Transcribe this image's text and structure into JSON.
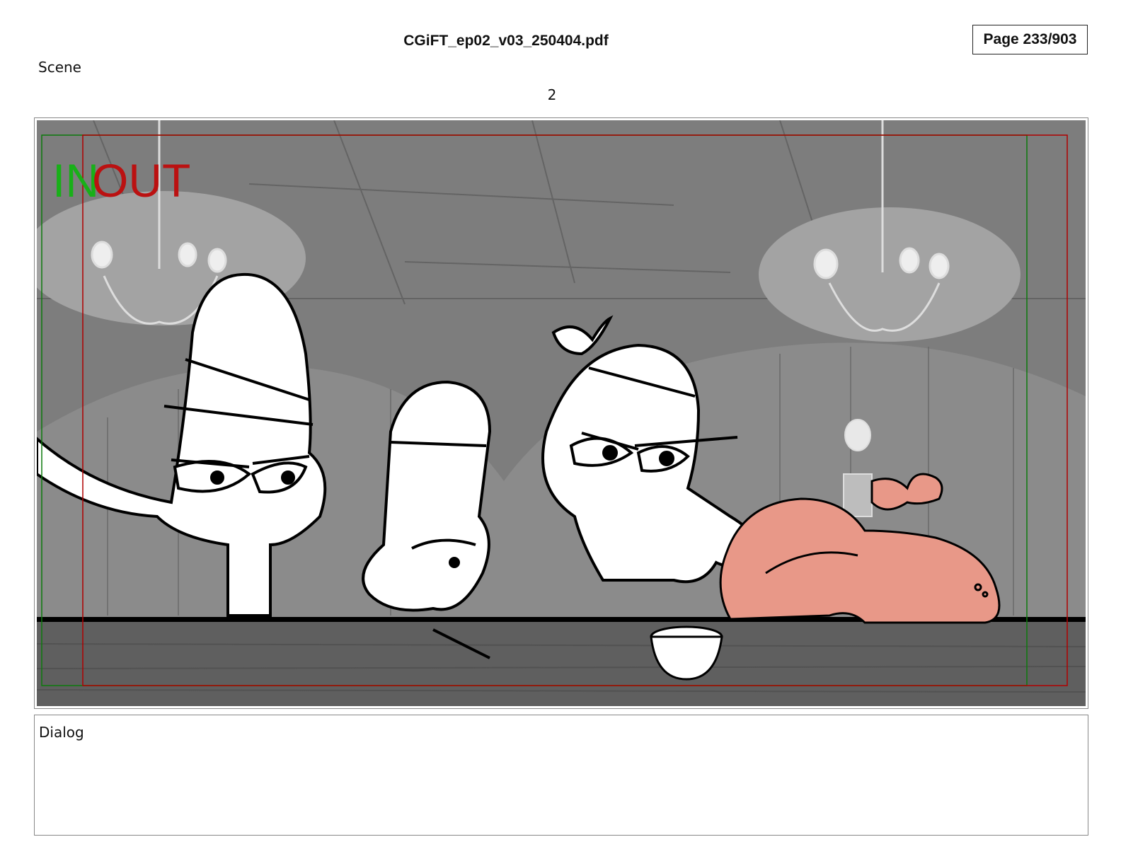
{
  "header": {
    "file_title": "CGiFT_ep02_v03_250404.pdf",
    "page_indicator": "Page 233/903"
  },
  "scene": {
    "label": "Scene",
    "number": "2"
  },
  "panel": {
    "in_marker": "IN",
    "out_marker": "OUT",
    "colors": {
      "in": "#18b018",
      "out": "#bb1111",
      "background": "#7d7d7d",
      "counter": "#5f5f5f",
      "highlighted_character": "#e89888"
    }
  },
  "dialog": {
    "label": "Dialog"
  }
}
